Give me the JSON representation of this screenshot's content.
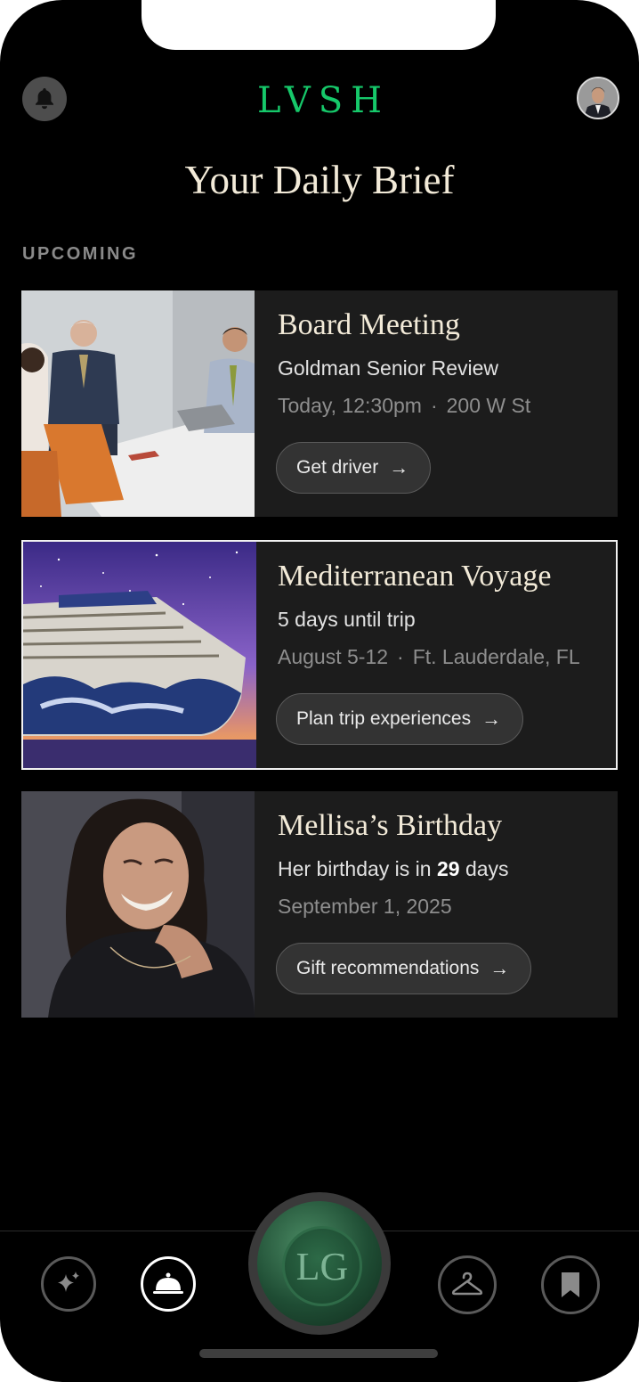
{
  "header": {
    "logo": "LVSH",
    "title": "Your Daily Brief",
    "bell_icon": "bell-icon",
    "avatar_icon": "profile-avatar"
  },
  "section_label": "UPCOMING",
  "cards": [
    {
      "title": "Board Meeting",
      "subtitle": "Goldman Senior Review",
      "meta_left": "Today, 12:30pm",
      "meta_sep": "·",
      "meta_right": "200 W St",
      "button": "Get driver",
      "arrow": "→"
    },
    {
      "title": "Mediterranean Voyage",
      "subtitle": "5 days until trip",
      "meta_left": "August 5-12",
      "meta_sep": "·",
      "meta_right": "Ft. Lauderdale, FL",
      "button": "Plan trip experiences",
      "arrow": "→",
      "selected": true
    },
    {
      "title": "Mellisa’s Birthday",
      "subtitle_prefix": "Her birthday is in",
      "subtitle_count": "29",
      "subtitle_suffix": "days",
      "meta_left": "September 1, 2025",
      "button": "Gift recommendations",
      "arrow": "→"
    }
  ],
  "tabbar": {
    "items": [
      "sparkle-icon",
      "service-bell-icon",
      "seal-logo",
      "hanger-icon",
      "bookmark-icon"
    ],
    "active": "service-bell-icon",
    "seal_monogram": "LG"
  },
  "colors": {
    "background": "#000000",
    "logo_green": "#16c86a",
    "title_cream": "#f2ead8",
    "card_bg": "#1c1c1c",
    "seal_green": "#1f4d34"
  }
}
